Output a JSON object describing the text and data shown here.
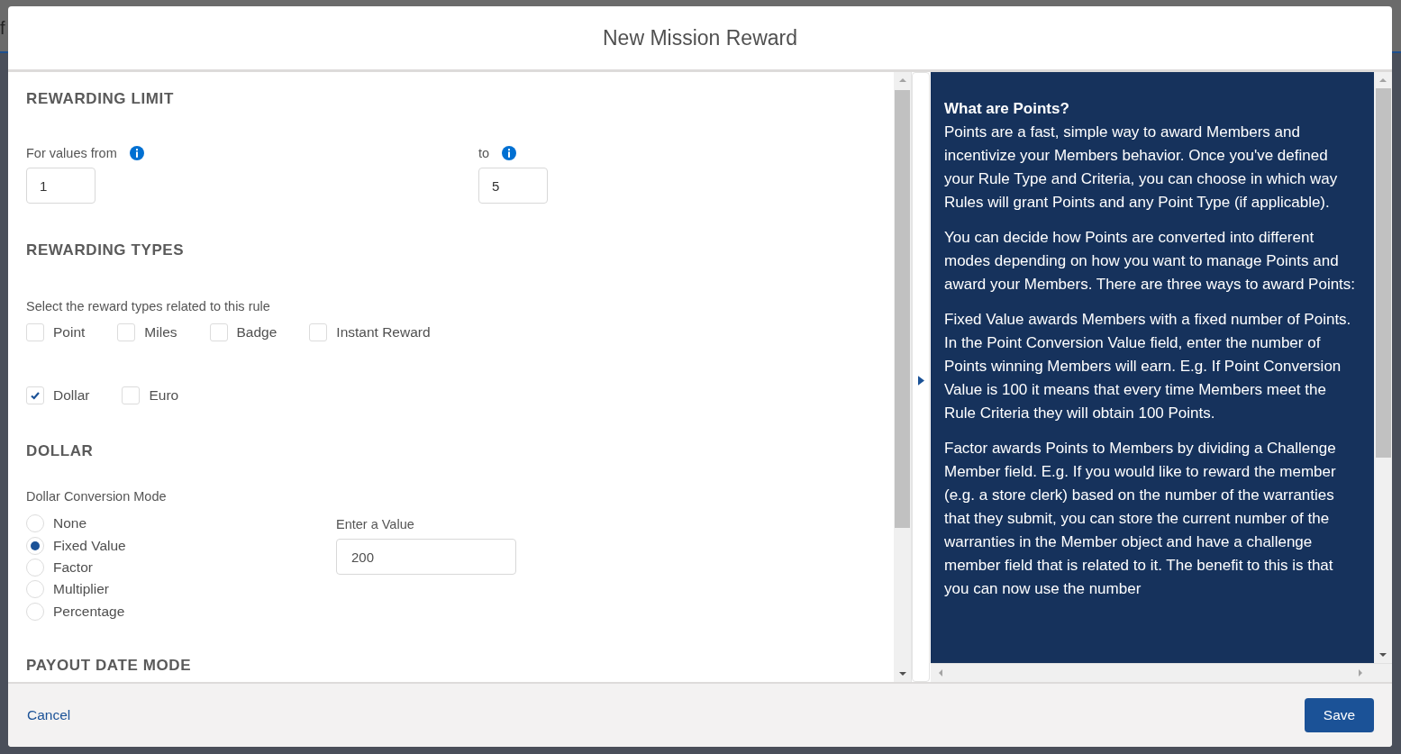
{
  "background": {
    "text": "f"
  },
  "modal": {
    "title": "New Mission Reward"
  },
  "rewarding_limit": {
    "heading": "REWARDING LIMIT",
    "fields": [
      {
        "label": "For values from",
        "value": "1"
      },
      {
        "label": "to",
        "value": "5"
      }
    ]
  },
  "rewarding_types": {
    "heading": "REWARDING TYPES",
    "hint": "Select the reward types related to this rule",
    "rows": [
      {
        "options": [
          {
            "label": "Point",
            "checked": false
          },
          {
            "label": "Miles",
            "checked": false
          },
          {
            "label": "Badge",
            "checked": false
          },
          {
            "label": "Instant Reward",
            "checked": false
          }
        ]
      },
      {
        "options": [
          {
            "label": "Dollar",
            "checked": true
          },
          {
            "label": "Euro",
            "checked": false
          }
        ]
      }
    ]
  },
  "dollar": {
    "heading": "DOLLAR",
    "mode_label": "Dollar Conversion Mode",
    "modes": [
      {
        "label": "None",
        "selected": false
      },
      {
        "label": "Fixed Value",
        "selected": true
      },
      {
        "label": "Factor",
        "selected": false
      },
      {
        "label": "Multiplier",
        "selected": false
      },
      {
        "label": "Percentage",
        "selected": false
      }
    ],
    "value_field": {
      "label": "Enter a Value",
      "value": "200"
    }
  },
  "payout": {
    "heading": "PAYOUT DATE MODE"
  },
  "help_panel": {
    "title": "What are Points?",
    "paragraphs": [
      "Points are a fast, simple way to award Members and incentivize your Members behavior. Once you've defined your Rule Type and Criteria, you can choose in which way Rules will grant Points and any Point Type (if applicable).",
      "You can decide how Points are converted into different modes depending on how you want to manage Points and award your Members. There are three ways to award Points:",
      "Fixed Value awards Members with a fixed number of Points. In the Point Conversion Value field, enter the number of Points winning Members will earn. E.g. If Point Conversion Value is 100 it means that every time Members meet the Rule Criteria they will obtain 100 Points.",
      "Factor awards Points to Members by dividing a Challenge Member field. E.g. If you would like to reward the member (e.g. a store clerk) based on the number of the warranties that they submit, you can store the current number of the warranties in the Member object and have a challenge member field that is related to it. The benefit to this is that you can now use the number"
    ]
  },
  "footer": {
    "cancel": "Cancel",
    "save": "Save"
  }
}
